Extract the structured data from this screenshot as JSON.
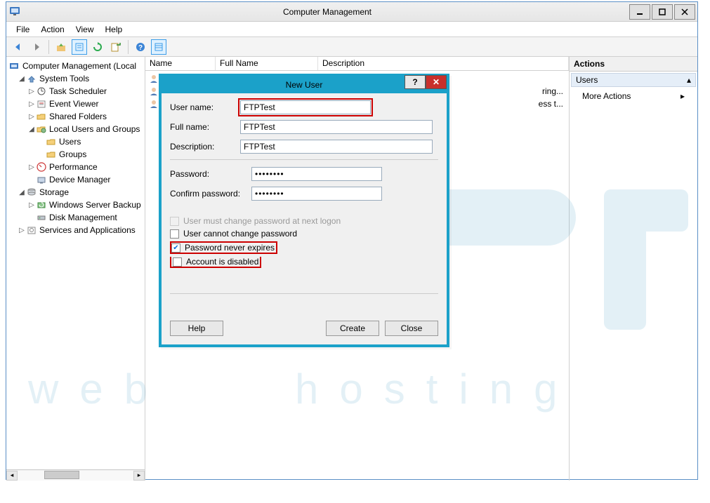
{
  "window": {
    "title": "Computer Management",
    "menus": [
      "File",
      "Action",
      "View",
      "Help"
    ]
  },
  "tree": {
    "root": "Computer Management (Local",
    "system_tools": "System Tools",
    "task_scheduler": "Task Scheduler",
    "event_viewer": "Event Viewer",
    "shared_folders": "Shared Folders",
    "local_users": "Local Users and Groups",
    "users": "Users",
    "groups": "Groups",
    "performance": "Performance",
    "device_manager": "Device Manager",
    "storage": "Storage",
    "wsb": "Windows Server Backup",
    "disk_mgmt": "Disk Management",
    "services": "Services and Applications"
  },
  "list": {
    "headers": {
      "name": "Name",
      "full": "Full Name",
      "desc": "Description"
    },
    "rows": [
      {
        "desc": ""
      },
      {
        "desc": "ring..."
      },
      {
        "desc": "ess t..."
      }
    ]
  },
  "actions": {
    "title": "Actions",
    "users": "Users",
    "more": "More Actions"
  },
  "dialog": {
    "title": "New User",
    "labels": {
      "username": "User name:",
      "fullname": "Full name:",
      "description": "Description:",
      "password": "Password:",
      "confirm": "Confirm password:"
    },
    "values": {
      "username": "FTPTest",
      "fullname": "FTPTest",
      "description": "FTPTest",
      "password": "••••••••",
      "confirm": "••••••••"
    },
    "checks": {
      "mustchange": "User must change password at next logon",
      "cannot": "User cannot change password",
      "never": "Password never expires",
      "disabled": "Account is disabled"
    },
    "buttons": {
      "help": "Help",
      "create": "Create",
      "close": "Close"
    }
  },
  "watermark": {
    "line1": "web",
    "line2": "hosting"
  },
  "icons": {
    "back": "back-icon",
    "fwd": "fwd-icon",
    "folder": "folder-icon",
    "props": "props-icon",
    "refresh": "refresh-icon",
    "export": "export-icon",
    "helpq": "help-icon"
  }
}
